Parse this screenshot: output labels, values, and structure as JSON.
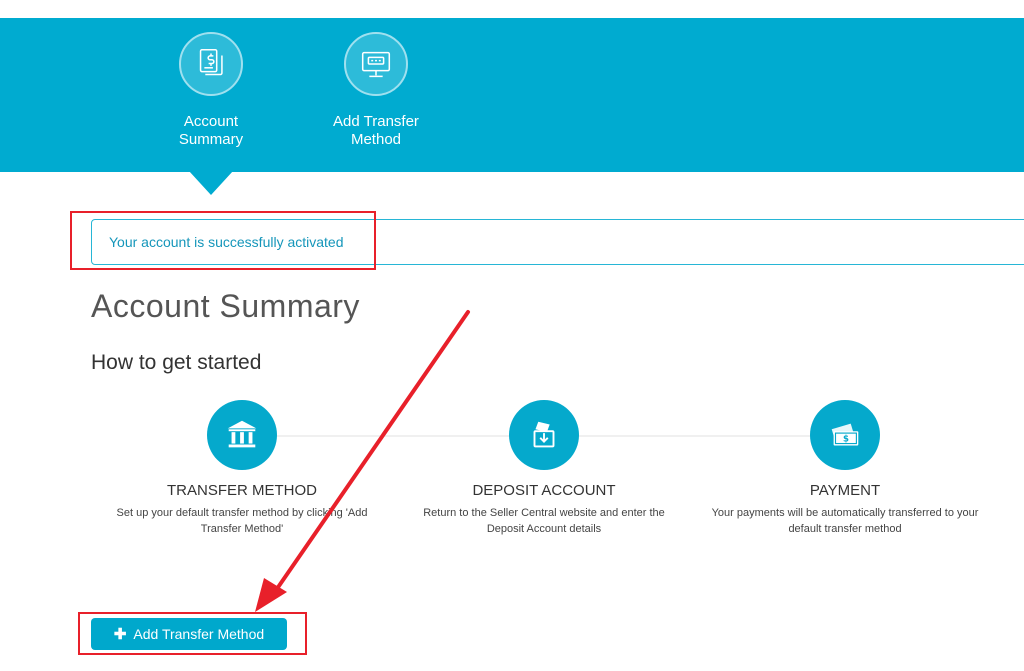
{
  "nav": {
    "items": [
      {
        "label": "Account Summary",
        "icon": "document-dollar-icon",
        "active": true
      },
      {
        "label": "Add Transfer Method",
        "icon": "monitor-transfer-icon",
        "active": false
      }
    ]
  },
  "alert": {
    "message": "Your account is successfully activated"
  },
  "main": {
    "title": "Account Summary",
    "subtitle": "How to get started",
    "steps": [
      {
        "title": "TRANSFER METHOD",
        "description": "Set up your default transfer method by clicking 'Add Transfer Method'",
        "icon": "bank-icon"
      },
      {
        "title": "DEPOSIT ACCOUNT",
        "description": "Return to the Seller Central website and enter the Deposit Account details",
        "icon": "deposit-icon"
      },
      {
        "title": "PAYMENT",
        "description": "Your payments will be automatically transferred to your default transfer method",
        "icon": "money-icon"
      }
    ],
    "add_button": {
      "label": "Add Transfer Method",
      "icon": "plus-icon"
    }
  },
  "colors": {
    "primary": "#00abd0",
    "annotation": "#e8202a",
    "text": "#333333"
  }
}
